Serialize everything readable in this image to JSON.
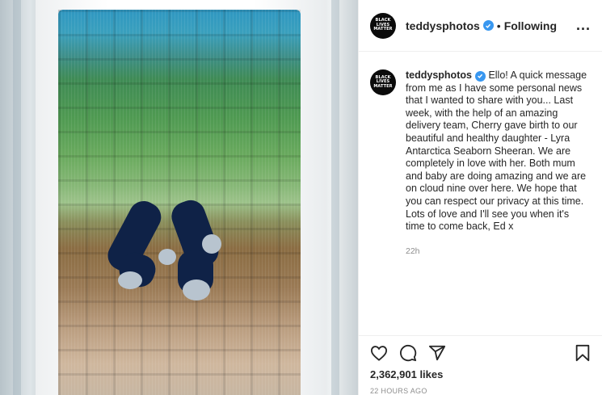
{
  "post": {
    "username": "teddysphotos",
    "separator": "•",
    "follow_state": "Following",
    "more_options": "...",
    "avatar_text": [
      "BLACK",
      "LIVES",
      "MATTER"
    ],
    "verified_icon": "verified-badge-icon",
    "caption": {
      "username": "teddysphotos",
      "text": "Ello! A quick message from me as I have some personal news that I wanted to share with you... Last week, with the help of an amazing delivery team, Cherry gave birth to our beautiful and healthy daughter - Lyra Antarctica Seaborn Sheeran. We are completely in love with her. Both mum and baby are doing amazing and we are on cloud nine over here. We hope that you can respect our privacy at this time. Lots of love and I'll see you when it's time to come back, Ed x",
      "time": "22h"
    },
    "actions": {
      "like_icon": "heart-icon",
      "comment_icon": "comment-icon",
      "share_icon": "share-icon",
      "save_icon": "bookmark-icon"
    },
    "likes": "2,362,901 likes",
    "posted_ago": "22 HOURS AGO",
    "colors": {
      "verified": "#3897f0",
      "text": "#262626",
      "muted": "#8e8e8e"
    }
  }
}
